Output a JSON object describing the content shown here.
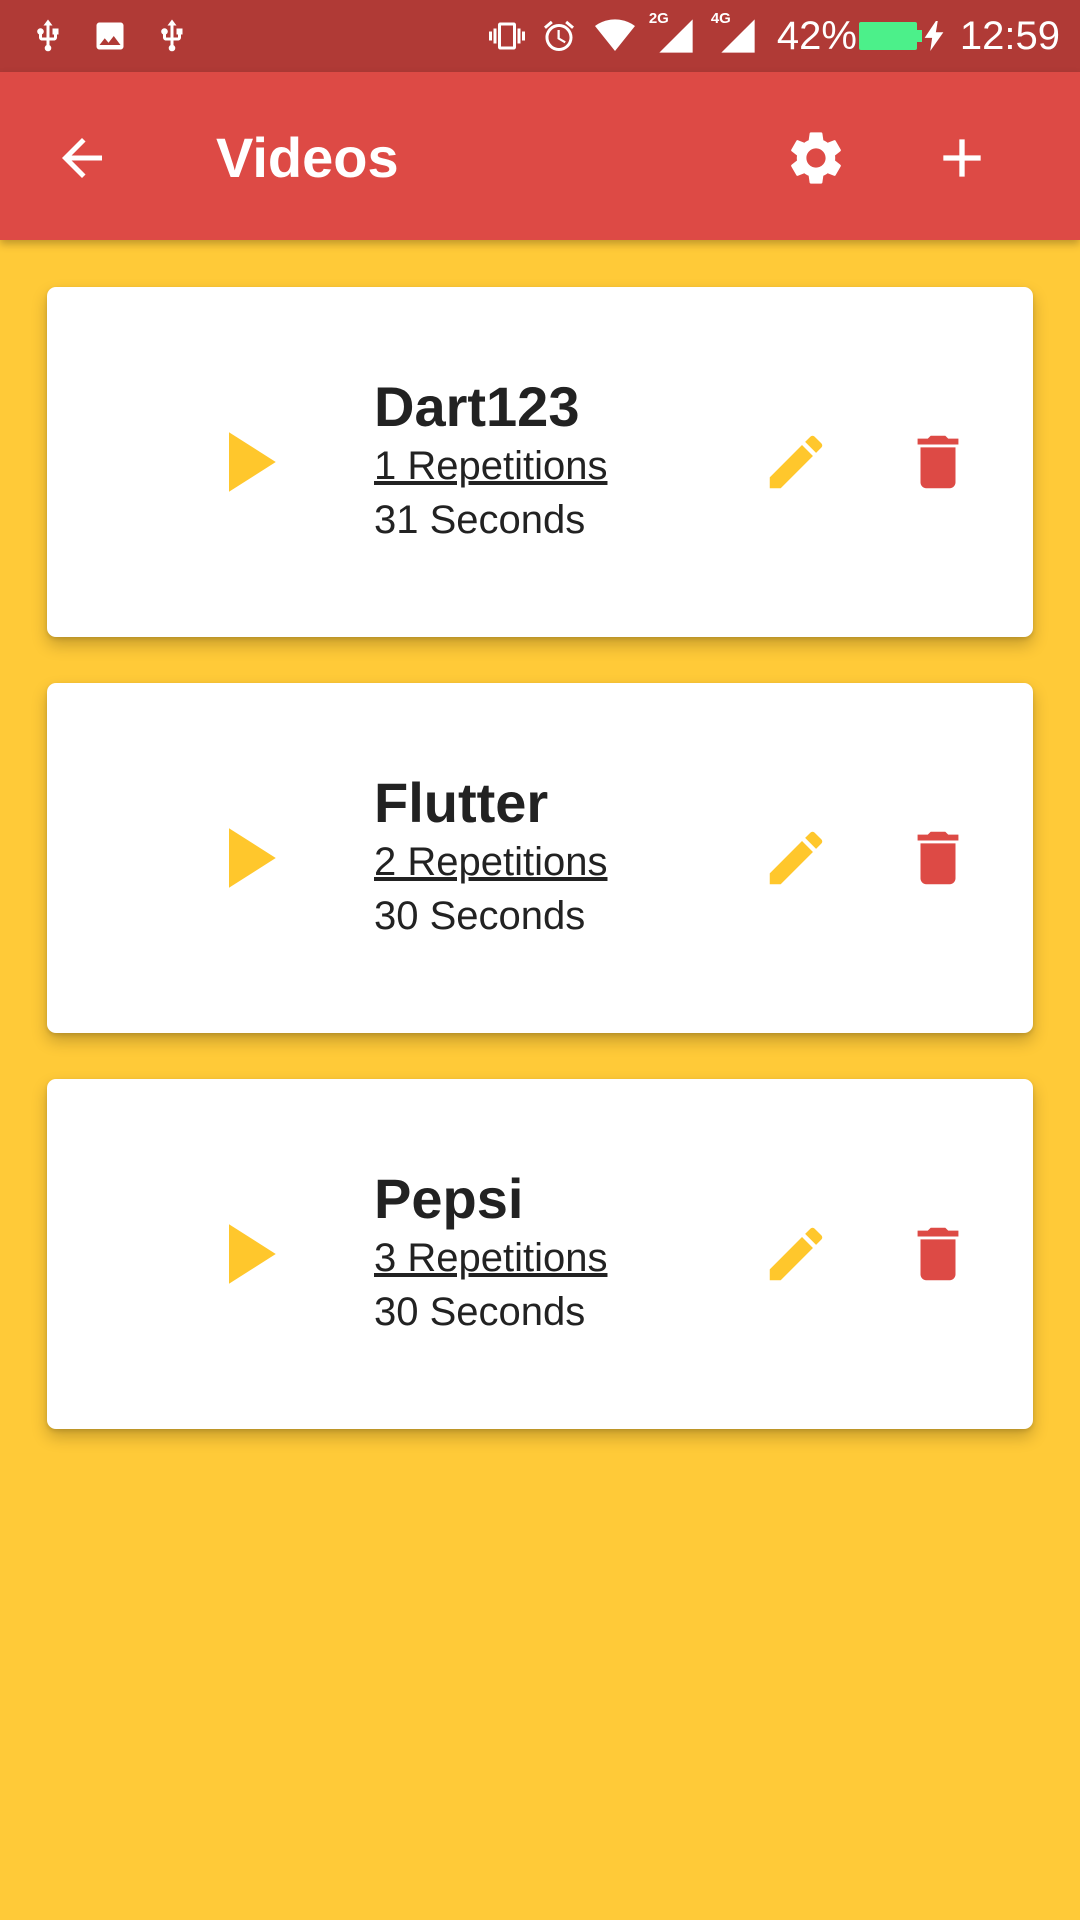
{
  "status_bar": {
    "icons_left": [
      "usb-icon",
      "image-icon",
      "usb-icon"
    ],
    "icons_right": [
      "vibrate-icon",
      "alarm-icon",
      "wifi-icon",
      "signal-2g-icon",
      "signal-4g-icon"
    ],
    "network_2g": "2G",
    "network_4g": "4G",
    "battery": "42%",
    "time": "12:59",
    "battery_color": "#4CF08A"
  },
  "app_bar": {
    "title": "Videos",
    "color": "#DD4A45"
  },
  "background_color": "#FFCA38",
  "videos": [
    {
      "name": "Dart123",
      "repetitions": "1 Repetitions",
      "seconds": "31 Seconds"
    },
    {
      "name": "Flutter",
      "repetitions": "2 Repetitions",
      "seconds": "30 Seconds"
    },
    {
      "name": "Pepsi",
      "repetitions": "3 Repetitions",
      "seconds": "30 Seconds"
    }
  ],
  "colors": {
    "play": "#FFC72C",
    "edit": "#FFC72C",
    "delete": "#DD4A45"
  }
}
